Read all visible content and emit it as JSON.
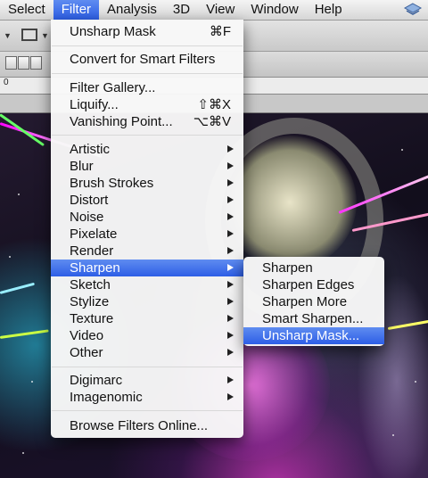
{
  "menubar": {
    "items": [
      {
        "label": "Select",
        "active": false
      },
      {
        "label": "Filter",
        "active": true
      },
      {
        "label": "Analysis",
        "active": false
      },
      {
        "label": "3D",
        "active": false
      },
      {
        "label": "View",
        "active": false
      },
      {
        "label": "Window",
        "active": false
      },
      {
        "label": "Help",
        "active": false
      }
    ],
    "status_icon": "sync-status-icon"
  },
  "ruler": {
    "label": "0"
  },
  "filter_menu": {
    "items": [
      {
        "label": "Unsharp Mask",
        "shortcut": "⌘F"
      },
      {
        "label": "Convert for Smart Filters",
        "shortcut": ""
      },
      {
        "label": "Filter Gallery...",
        "shortcut": ""
      },
      {
        "label": "Liquify...",
        "shortcut": "⇧⌘X"
      },
      {
        "label": "Vanishing Point...",
        "shortcut": "⌥⌘V"
      },
      {
        "label": "Artistic",
        "submenu": true
      },
      {
        "label": "Blur",
        "submenu": true
      },
      {
        "label": "Brush Strokes",
        "submenu": true
      },
      {
        "label": "Distort",
        "submenu": true
      },
      {
        "label": "Noise",
        "submenu": true
      },
      {
        "label": "Pixelate",
        "submenu": true
      },
      {
        "label": "Render",
        "submenu": true
      },
      {
        "label": "Sharpen",
        "submenu": true,
        "highlighted": true
      },
      {
        "label": "Sketch",
        "submenu": true
      },
      {
        "label": "Stylize",
        "submenu": true
      },
      {
        "label": "Texture",
        "submenu": true
      },
      {
        "label": "Video",
        "submenu": true
      },
      {
        "label": "Other",
        "submenu": true
      },
      {
        "label": "Digimarc",
        "submenu": true
      },
      {
        "label": "Imagenomic",
        "submenu": true
      },
      {
        "label": "Browse Filters Online...",
        "shortcut": ""
      }
    ]
  },
  "sharpen_submenu": {
    "items": [
      {
        "label": "Sharpen"
      },
      {
        "label": "Sharpen Edges"
      },
      {
        "label": "Sharpen More"
      },
      {
        "label": "Smart Sharpen..."
      },
      {
        "label": "Unsharp Mask...",
        "highlighted": true
      }
    ]
  },
  "colors": {
    "highlight": "#2d5ee6",
    "menu_bg": "#f8f8f8"
  }
}
